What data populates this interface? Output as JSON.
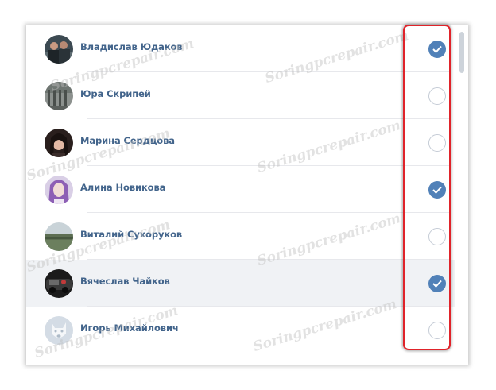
{
  "contacts": [
    {
      "name": "Владислав Юдаков",
      "selected": true,
      "avatar": "photo-two-men"
    },
    {
      "name": "Юра Скрипей",
      "selected": false,
      "avatar": "photo-building"
    },
    {
      "name": "Марина Сердцова",
      "selected": false,
      "avatar": "photo-woman-dark-hair"
    },
    {
      "name": "Алина Новикова",
      "selected": true,
      "avatar": "photo-purple-hair"
    },
    {
      "name": "Виталий Сухоруков",
      "selected": false,
      "avatar": "photo-landscape"
    },
    {
      "name": "Вячеслав Чайков",
      "selected": true,
      "avatar": "photo-car"
    },
    {
      "name": "Игорь Михайлович",
      "selected": false,
      "avatar": "default-dog-avatar"
    }
  ],
  "watermark": "Soringpcrepair.com",
  "colors": {
    "name_link": "#42648b",
    "check_on": "#5181b8",
    "highlight_border": "#e0232a",
    "hover_row": "#f0f2f5"
  }
}
